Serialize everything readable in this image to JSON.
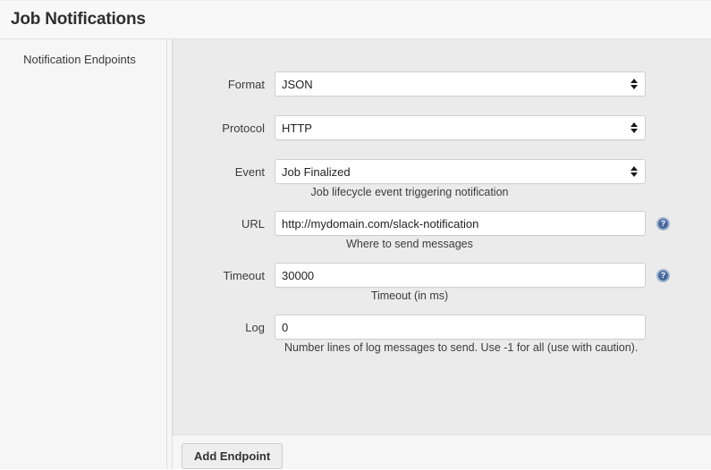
{
  "header": {
    "title": "Job Notifications"
  },
  "sidebar": {
    "section_label": "Notification Endpoints"
  },
  "form": {
    "rows": [
      {
        "label": "Format",
        "type": "select",
        "value": "JSON",
        "help": "",
        "has_help_icon": false
      },
      {
        "label": "Protocol",
        "type": "select",
        "value": "HTTP",
        "help": "",
        "has_help_icon": false
      },
      {
        "label": "Event",
        "type": "select",
        "value": "Job Finalized",
        "help": "Job lifecycle event triggering notification",
        "has_help_icon": false
      },
      {
        "label": "URL",
        "type": "text",
        "value": "http://mydomain.com/slack-notification",
        "placeholder": "",
        "help": "Where to send messages",
        "has_help_icon": true
      },
      {
        "label": "Timeout",
        "type": "text",
        "value": "30000",
        "placeholder": "",
        "help": "Timeout (in ms)",
        "has_help_icon": true
      },
      {
        "label": "Log",
        "type": "text",
        "value": "0",
        "placeholder": "",
        "help": "Number lines of log messages to send. Use -1 for all (use with caution).",
        "has_help_icon": false
      }
    ]
  },
  "footer": {
    "add_endpoint_label": "Add Endpoint"
  },
  "icons": {
    "help_glyph": "?"
  },
  "colors": {
    "title_bar_bg": "#f8f8f8",
    "sidebar_bg": "#f6f6f6",
    "panel_bg": "#ebebeb",
    "input_bg": "#ffffff",
    "input_border": "#cfcfcf",
    "help_icon_fill": "#4a6a9e",
    "help_icon_ring": "#9fb4d0",
    "button_bg": "#eeeeee",
    "text": "#333333"
  }
}
